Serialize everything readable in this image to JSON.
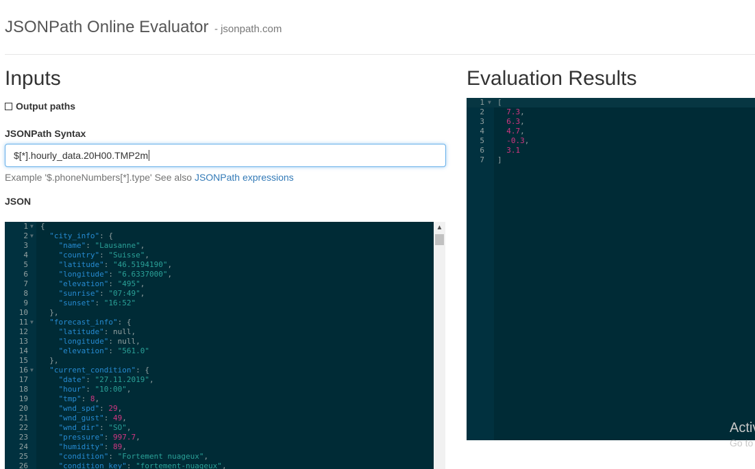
{
  "header": {
    "title": "JSONPath Online Evaluator",
    "subtitle": "- jsonpath.com"
  },
  "inputs": {
    "heading": "Inputs",
    "output_paths_label": "Output paths",
    "syntax_label": "JSONPath Syntax",
    "syntax_value": "$[*].hourly_data.20H00.TMP2m",
    "example_text": "Example '$.phoneNumbers[*].type' See also",
    "example_link": "JSONPath expressions",
    "json_label": "JSON"
  },
  "results": {
    "heading": "Evaluation Results"
  },
  "json_lines": [
    {
      "n": "1",
      "fold": true,
      "parts": [
        [
          "p",
          "{"
        ]
      ]
    },
    {
      "n": "2",
      "fold": true,
      "parts": [
        [
          "p",
          "  "
        ],
        [
          "k",
          "\"city_info\""
        ],
        [
          "p",
          ": {"
        ]
      ]
    },
    {
      "n": "3",
      "parts": [
        [
          "p",
          "    "
        ],
        [
          "k",
          "\"name\""
        ],
        [
          "p",
          ": "
        ],
        [
          "s",
          "\"Lausanne\""
        ],
        [
          "p",
          ","
        ]
      ]
    },
    {
      "n": "4",
      "parts": [
        [
          "p",
          "    "
        ],
        [
          "k",
          "\"country\""
        ],
        [
          "p",
          ": "
        ],
        [
          "s",
          "\"Suisse\""
        ],
        [
          "p",
          ","
        ]
      ]
    },
    {
      "n": "5",
      "parts": [
        [
          "p",
          "    "
        ],
        [
          "k",
          "\"latitude\""
        ],
        [
          "p",
          ": "
        ],
        [
          "s",
          "\"46.5194190\""
        ],
        [
          "p",
          ","
        ]
      ]
    },
    {
      "n": "6",
      "parts": [
        [
          "p",
          "    "
        ],
        [
          "k",
          "\"longitude\""
        ],
        [
          "p",
          ": "
        ],
        [
          "s",
          "\"6.6337000\""
        ],
        [
          "p",
          ","
        ]
      ]
    },
    {
      "n": "7",
      "parts": [
        [
          "p",
          "    "
        ],
        [
          "k",
          "\"elevation\""
        ],
        [
          "p",
          ": "
        ],
        [
          "s",
          "\"495\""
        ],
        [
          "p",
          ","
        ]
      ]
    },
    {
      "n": "8",
      "parts": [
        [
          "p",
          "    "
        ],
        [
          "k",
          "\"sunrise\""
        ],
        [
          "p",
          ": "
        ],
        [
          "s",
          "\"07:49\""
        ],
        [
          "p",
          ","
        ]
      ]
    },
    {
      "n": "9",
      "parts": [
        [
          "p",
          "    "
        ],
        [
          "k",
          "\"sunset\""
        ],
        [
          "p",
          ": "
        ],
        [
          "s",
          "\"16:52\""
        ]
      ]
    },
    {
      "n": "10",
      "parts": [
        [
          "p",
          "  },"
        ]
      ]
    },
    {
      "n": "11",
      "fold": true,
      "parts": [
        [
          "p",
          "  "
        ],
        [
          "k",
          "\"forecast_info\""
        ],
        [
          "p",
          ": {"
        ]
      ]
    },
    {
      "n": "12",
      "parts": [
        [
          "p",
          "    "
        ],
        [
          "k",
          "\"latitude\""
        ],
        [
          "p",
          ": null,"
        ]
      ]
    },
    {
      "n": "13",
      "parts": [
        [
          "p",
          "    "
        ],
        [
          "k",
          "\"longitude\""
        ],
        [
          "p",
          ": null,"
        ]
      ]
    },
    {
      "n": "14",
      "parts": [
        [
          "p",
          "    "
        ],
        [
          "k",
          "\"elevation\""
        ],
        [
          "p",
          ": "
        ],
        [
          "s",
          "\"561.0\""
        ]
      ]
    },
    {
      "n": "15",
      "parts": [
        [
          "p",
          "  },"
        ]
      ]
    },
    {
      "n": "16",
      "fold": true,
      "parts": [
        [
          "p",
          "  "
        ],
        [
          "k",
          "\"current_condition\""
        ],
        [
          "p",
          ": {"
        ]
      ]
    },
    {
      "n": "17",
      "parts": [
        [
          "p",
          "    "
        ],
        [
          "k",
          "\"date\""
        ],
        [
          "p",
          ": "
        ],
        [
          "s",
          "\"27.11.2019\""
        ],
        [
          "p",
          ","
        ]
      ]
    },
    {
      "n": "18",
      "parts": [
        [
          "p",
          "    "
        ],
        [
          "k",
          "\"hour\""
        ],
        [
          "p",
          ": "
        ],
        [
          "s",
          "\"10:00\""
        ],
        [
          "p",
          ","
        ]
      ]
    },
    {
      "n": "19",
      "parts": [
        [
          "p",
          "    "
        ],
        [
          "k",
          "\"tmp\""
        ],
        [
          "p",
          ": "
        ],
        [
          "n",
          "8"
        ],
        [
          "p",
          ","
        ]
      ]
    },
    {
      "n": "20",
      "parts": [
        [
          "p",
          "    "
        ],
        [
          "k",
          "\"wnd_spd\""
        ],
        [
          "p",
          ": "
        ],
        [
          "n",
          "29"
        ],
        [
          "p",
          ","
        ]
      ]
    },
    {
      "n": "21",
      "parts": [
        [
          "p",
          "    "
        ],
        [
          "k",
          "\"wnd_gust\""
        ],
        [
          "p",
          ": "
        ],
        [
          "n",
          "49"
        ],
        [
          "p",
          ","
        ]
      ]
    },
    {
      "n": "22",
      "parts": [
        [
          "p",
          "    "
        ],
        [
          "k",
          "\"wnd_dir\""
        ],
        [
          "p",
          ": "
        ],
        [
          "s",
          "\"SO\""
        ],
        [
          "p",
          ","
        ]
      ]
    },
    {
      "n": "23",
      "parts": [
        [
          "p",
          "    "
        ],
        [
          "k",
          "\"pressure\""
        ],
        [
          "p",
          ": "
        ],
        [
          "n",
          "997.7"
        ],
        [
          "p",
          ","
        ]
      ]
    },
    {
      "n": "24",
      "parts": [
        [
          "p",
          "    "
        ],
        [
          "k",
          "\"humidity\""
        ],
        [
          "p",
          ": "
        ],
        [
          "n",
          "89"
        ],
        [
          "p",
          ","
        ]
      ]
    },
    {
      "n": "25",
      "parts": [
        [
          "p",
          "    "
        ],
        [
          "k",
          "\"condition\""
        ],
        [
          "p",
          ": "
        ],
        [
          "s",
          "\"Fortement nuageux\""
        ],
        [
          "p",
          ","
        ]
      ]
    },
    {
      "n": "26",
      "parts": [
        [
          "p",
          "    "
        ],
        [
          "k",
          "\"condition_key\""
        ],
        [
          "p",
          ": "
        ],
        [
          "s",
          "\"fortement-nuageux\""
        ],
        [
          "p",
          ","
        ]
      ]
    }
  ],
  "result_lines": [
    {
      "n": "1",
      "fold": true,
      "active": true,
      "parts": [
        [
          "p",
          "["
        ]
      ]
    },
    {
      "n": "2",
      "parts": [
        [
          "p",
          "  "
        ],
        [
          "n",
          "7.3"
        ],
        [
          "p",
          ","
        ]
      ]
    },
    {
      "n": "3",
      "parts": [
        [
          "p",
          "  "
        ],
        [
          "n",
          "6.3"
        ],
        [
          "p",
          ","
        ]
      ]
    },
    {
      "n": "4",
      "parts": [
        [
          "p",
          "  "
        ],
        [
          "n",
          "4.7"
        ],
        [
          "p",
          ","
        ]
      ]
    },
    {
      "n": "5",
      "parts": [
        [
          "p",
          "  "
        ],
        [
          "n",
          "-0.3"
        ],
        [
          "p",
          ","
        ]
      ]
    },
    {
      "n": "6",
      "parts": [
        [
          "p",
          "  "
        ],
        [
          "n",
          "3.1"
        ]
      ]
    },
    {
      "n": "7",
      "parts": [
        [
          "p",
          "]"
        ]
      ]
    }
  ],
  "watermark": {
    "line1": "Activ",
    "line2": "Go to"
  },
  "colors": {
    "editor_bg": "#002b36",
    "key": "#268bd2",
    "string": "#2aa198",
    "number": "#d33682",
    "link": "#337ab7"
  }
}
